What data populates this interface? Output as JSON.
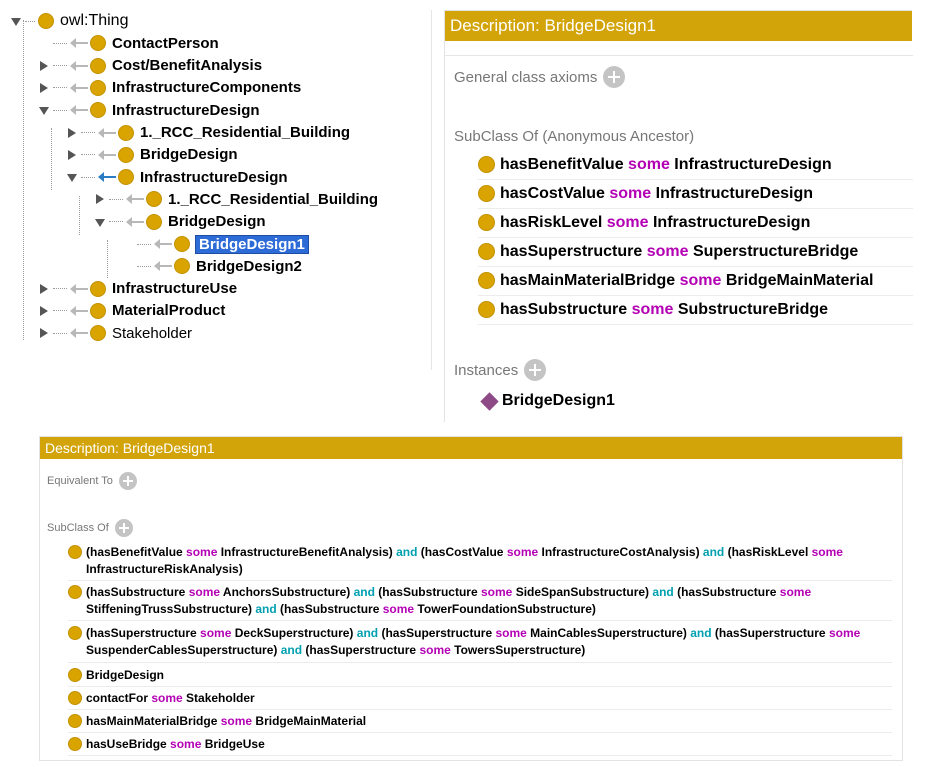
{
  "tree": [
    {
      "label": "owl:Thing",
      "toggle": "expanded",
      "arrow": "none",
      "bold": false,
      "level": 0
    },
    {
      "label": "ContactPerson",
      "toggle": "leaf",
      "arrow": "gray",
      "bold": true,
      "level": 1
    },
    {
      "label": "Cost/BenefitAnalysis",
      "toggle": "collapsed",
      "arrow": "gray",
      "bold": true,
      "level": 1
    },
    {
      "label": "InfrastructureComponents",
      "toggle": "collapsed",
      "arrow": "gray",
      "bold": true,
      "level": 1
    },
    {
      "label": "InfrastructureDesign",
      "toggle": "expanded",
      "arrow": "gray",
      "bold": true,
      "level": 1
    },
    {
      "label": "1._RCC_Residential_Building",
      "toggle": "collapsed",
      "arrow": "gray",
      "bold": true,
      "level": 2
    },
    {
      "label": "BridgeDesign",
      "toggle": "collapsed",
      "arrow": "gray",
      "bold": true,
      "level": 2
    },
    {
      "label": "InfrastructureDesign",
      "toggle": "expanded",
      "arrow": "blue",
      "bold": true,
      "level": 2
    },
    {
      "label": "1._RCC_Residential_Building",
      "toggle": "collapsed",
      "arrow": "gray",
      "bold": true,
      "level": 3
    },
    {
      "label": "BridgeDesign",
      "toggle": "expanded",
      "arrow": "gray",
      "bold": true,
      "level": 3
    },
    {
      "label": "BridgeDesign1",
      "toggle": "leaf",
      "arrow": "gray",
      "bold": true,
      "level": 4,
      "selected": true
    },
    {
      "label": "BridgeDesign2",
      "toggle": "leaf",
      "arrow": "gray",
      "bold": true,
      "level": 4
    },
    {
      "label": "InfrastructureUse",
      "toggle": "collapsed",
      "arrow": "gray",
      "bold": true,
      "level": 1
    },
    {
      "label": "MaterialProduct",
      "toggle": "collapsed",
      "arrow": "gray",
      "bold": true,
      "level": 1
    },
    {
      "label": "Stakeholder",
      "toggle": "collapsed",
      "arrow": "gray",
      "bold": false,
      "level": 1
    }
  ],
  "top_panel": {
    "title": "Description: BridgeDesign1",
    "general_axioms_label": "General class axioms",
    "subclass_anon_label": "SubClass Of (Anonymous Ancestor)",
    "instances_label": "Instances",
    "axioms": [
      [
        "hasBenefitValue",
        " some ",
        "InfrastructureDesign"
      ],
      [
        "hasCostValue",
        " some ",
        "InfrastructureDesign"
      ],
      [
        "hasRiskLevel",
        " some ",
        "InfrastructureDesign"
      ],
      [
        "hasSuperstructure",
        " some ",
        "SuperstructureBridge"
      ],
      [
        "hasMainMaterialBridge",
        " some ",
        "BridgeMainMaterial"
      ],
      [
        "hasSubstructure",
        " some ",
        "SubstructureBridge"
      ]
    ],
    "instance": "BridgeDesign1"
  },
  "bottom_panel": {
    "title": "Description: BridgeDesign1",
    "equivalent_label": "Equivalent To",
    "subclass_label": "SubClass Of",
    "axioms": [
      [
        "(hasBenefitValue ",
        "some",
        " InfrastructureBenefitAnalysis) ",
        "and",
        " (hasCostValue ",
        "some",
        " InfrastructureCostAnalysis) ",
        "and",
        " (hasRiskLevel ",
        "some",
        " InfrastructureRiskAnalysis)"
      ],
      [
        "(hasSubstructure ",
        "some",
        " AnchorsSubstructure) ",
        "and",
        " (hasSubstructure ",
        "some",
        " SideSpanSubstructure) ",
        "and",
        " (hasSubstructure ",
        "some",
        " StiffeningTrussSubstructure) ",
        "and",
        " (hasSubstructure ",
        "some",
        " TowerFoundationSubstructure)"
      ],
      [
        "(hasSuperstructure ",
        "some",
        " DeckSuperstructure) ",
        "and",
        " (hasSuperstructure ",
        "some",
        " MainCablesSuperstructure) ",
        "and",
        " (hasSuperstructure ",
        "some",
        " SuspenderCablesSuperstructure) ",
        "and",
        " (hasSuperstructure ",
        "some",
        " TowersSuperstructure)"
      ],
      [
        "BridgeDesign"
      ],
      [
        "contactFor ",
        "some",
        " Stakeholder"
      ],
      [
        "hasMainMaterialBridge ",
        "some",
        " BridgeMainMaterial"
      ],
      [
        "hasUseBridge ",
        "some",
        " BridgeUse"
      ]
    ]
  },
  "colors": {
    "header": "#d3a40a",
    "class_dot": "#d9a400",
    "some_keyword": "#b400b4",
    "and_keyword": "#00a0b0",
    "selection": "#2d6bd6",
    "instance": "#8e4a86"
  },
  "icons": {
    "class": "class-dot-icon",
    "subclass_arrow": "arrow-left-icon",
    "instance": "individual-diamond-icon",
    "add": "add-circle-icon"
  }
}
